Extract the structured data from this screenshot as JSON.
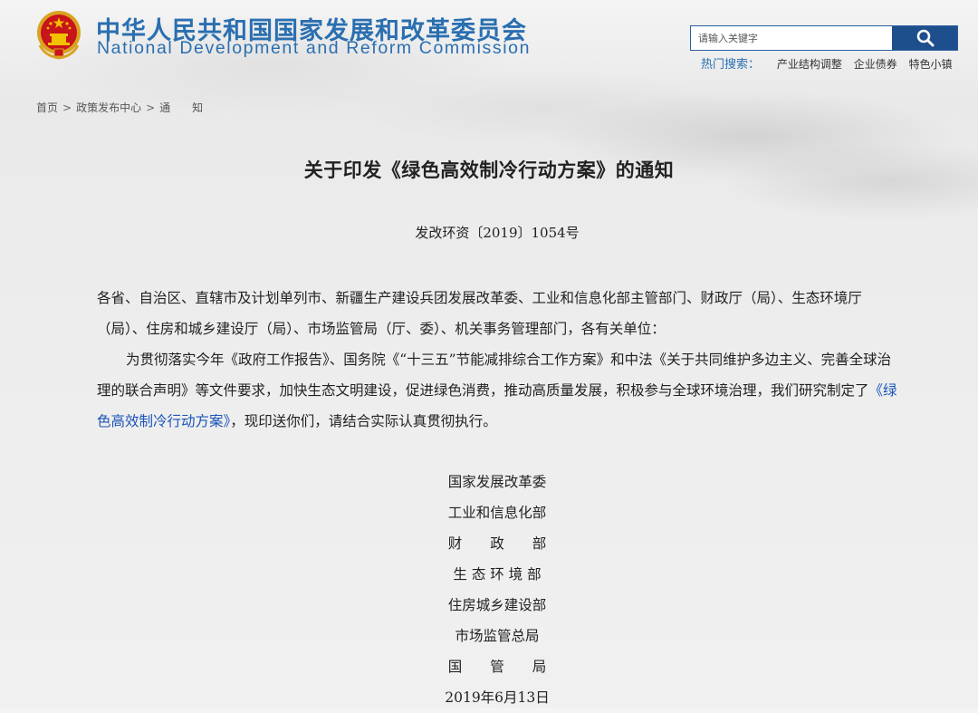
{
  "header": {
    "title_cn": "中华人民共和国国家发展和改革委员会",
    "title_en": "National Development and Reform Commission",
    "search": {
      "placeholder": "请输入关键字"
    },
    "hot_label": "热门搜索：",
    "hot_links": [
      "产业结构调整",
      "企业债券",
      "特色小镇"
    ]
  },
  "breadcrumb": {
    "items": [
      "首页",
      "政策发布中心",
      "通　　知"
    ],
    "separator": ">"
  },
  "article": {
    "title": "关于印发《绿色高效制冷行动方案》的通知",
    "doc_number": "发改环资〔2019〕1054号",
    "addressee": "各省、自治区、直辖市及计划单列市、新疆生产建设兵团发展改革委、工业和信息化部主管部门、财政厅（局）、生态环境厅（局）、住房和城乡建设厅（局）、市场监管局（厅、委）、机关事务管理部门，各有关单位：",
    "body_before_link": "为贯彻落实今年《政府工作报告》、国务院《“十三五”节能减排综合工作方案》和中法《关于共同维护多边主义、完善全球治理的联合声明》等文件要求，加快生态文明建设，促进绿色消费，推动高质量发展，积极参与全球环境治理，我们研究制定了",
    "link_text": "《绿色高效制冷行动方案》",
    "body_after_link": "，现印送你们，请结合实际认真贯彻执行。",
    "signatories": [
      "国家发展改革委",
      "工业和信息化部",
      "财　　政　　部",
      "生 态 环 境 部",
      "住房城乡建设部",
      "市场监管总局",
      "国　　管　　局"
    ],
    "date": "2019年6月13日"
  },
  "colors": {
    "brand_blue": "#2a6fb0",
    "search_button": "#1d4f8c",
    "link": "#1a55b8"
  }
}
